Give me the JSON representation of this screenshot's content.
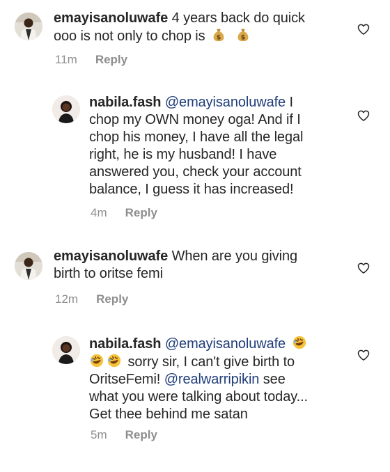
{
  "comments": [
    {
      "user": "emayisanoluwafe",
      "text_1": " 4 years back do quick",
      "text_2": "ooo is not only to chop is ",
      "emojis": [
        "money-bag",
        "money-bag"
      ],
      "time": "11m",
      "reply_label": "Reply"
    },
    {
      "user": "nabila.fash",
      "mention": "@emayisanoluwafe",
      "text_1": " I",
      "text_2": "chop my OWN money oga! And if I",
      "text_3": "chop his money, I have all the legal",
      "text_4": "right, he is my husband! I have",
      "text_5": "answered you, check your account",
      "text_6": "balance, I guess it has increased!",
      "time": "4m",
      "reply_label": "Reply"
    },
    {
      "user": "emayisanoluwafe",
      "text_1": " When are you giving",
      "text_2": "birth to oritse femi",
      "time": "12m",
      "reply_label": "Reply"
    },
    {
      "user": "nabila.fash",
      "mention": "@emayisanoluwafe",
      "emojis": [
        "rolling-laughing",
        "rolling-laughing",
        "rolling-laughing"
      ],
      "text_2": " sorry sir, I can't give birth to",
      "text_3": "OritseFemi! ",
      "mention_2": "@realwarripikin",
      "text_3b": " see",
      "text_4": "what you were talking about today...",
      "text_5": "Get thee behind me satan",
      "time": "5m",
      "reply_label": "Reply"
    }
  ],
  "colors": {
    "text": "#262626",
    "mention": "#1f3d7a",
    "meta": "#8e8e8e"
  },
  "icons": [
    "heart-icon",
    "money-bag-emoji",
    "rolling-laughing-emoji"
  ]
}
